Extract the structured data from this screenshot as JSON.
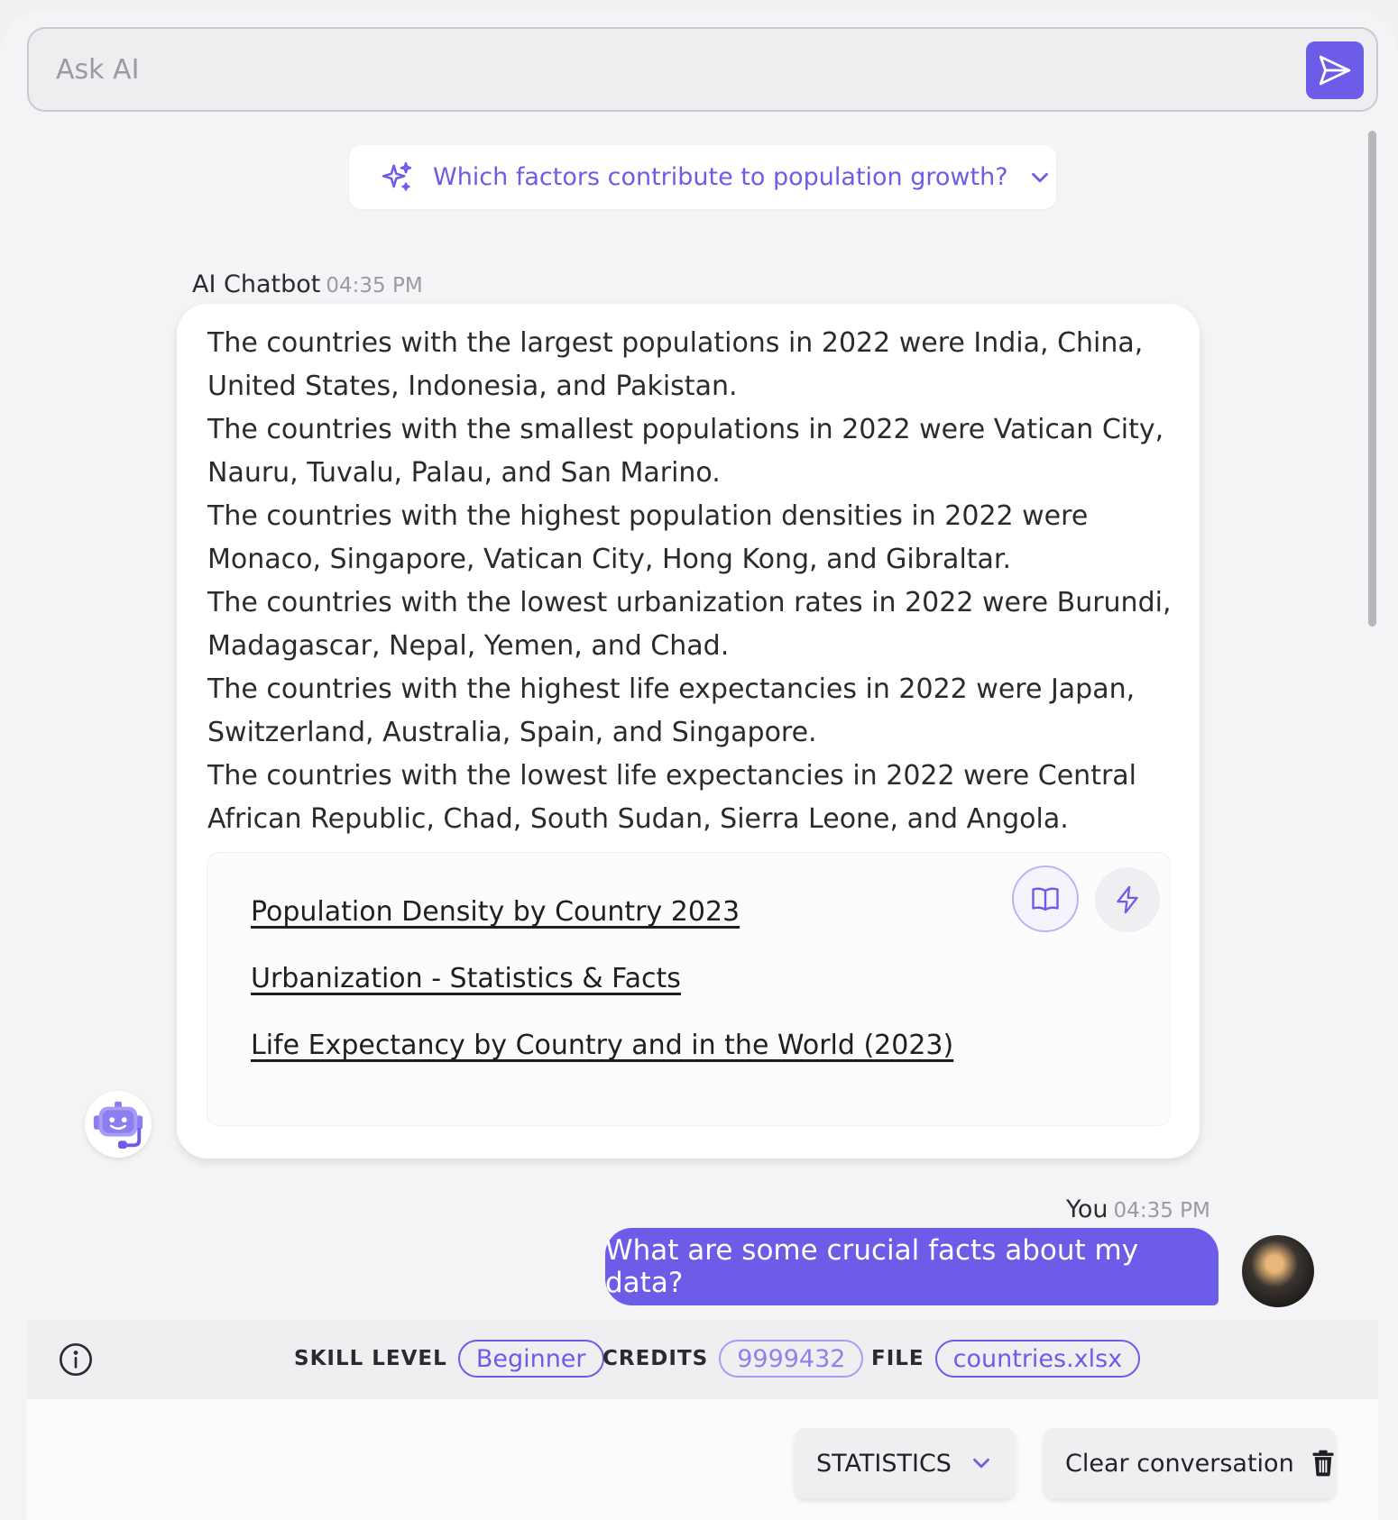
{
  "ask": {
    "placeholder": "Ask AI"
  },
  "suggestion": {
    "label": "Which factors contribute to population growth?"
  },
  "bot_message": {
    "sender": "AI Chatbot",
    "time": "04:35 PM",
    "paragraphs": [
      "The countries with the largest populations in 2022 were India, China, United States, Indonesia, and Pakistan.",
      "The countries with the smallest populations in 2022 were Vatican City, Nauru, Tuvalu, Palau, and San Marino.",
      "The countries with the highest population densities in 2022 were Monaco, Singapore, Vatican City, Hong Kong, and Gibraltar.",
      "The countries with the lowest urbanization rates in 2022 were Burundi, Madagascar, Nepal, Yemen, and Chad.",
      "The countries with the highest life expectancies in 2022 were Japan, Switzerland, Australia, Spain, and Singapore.",
      "The countries with the lowest life expectancies in 2022 were Central African Republic, Chad, South Sudan, Sierra Leone, and Angola."
    ],
    "references": [
      "Population Density by Country 2023",
      "Urbanization - Statistics & Facts",
      "Life Expectancy by Country and in the World (2023)"
    ]
  },
  "user_message": {
    "sender": "You",
    "time": "04:35 PM",
    "text": "What are some crucial facts about my data?"
  },
  "status": {
    "skill_label": "SKILL LEVEL",
    "skill_value": "Beginner",
    "credits_label": "CREDITS",
    "credits_value": "9999432",
    "file_label": "FILE",
    "file_value": "countries.xlsx"
  },
  "footer": {
    "mode_label": "STATISTICS",
    "clear_label": "Clear conversation"
  },
  "colors": {
    "accent": "#6c5ce7",
    "background": "#f4f4f6",
    "bubble": "#ffffff"
  },
  "icons": [
    "send-icon",
    "sparkle-icon",
    "chevron-down-icon",
    "book-icon",
    "lightning-icon",
    "robot-icon",
    "info-icon",
    "trash-icon"
  ]
}
